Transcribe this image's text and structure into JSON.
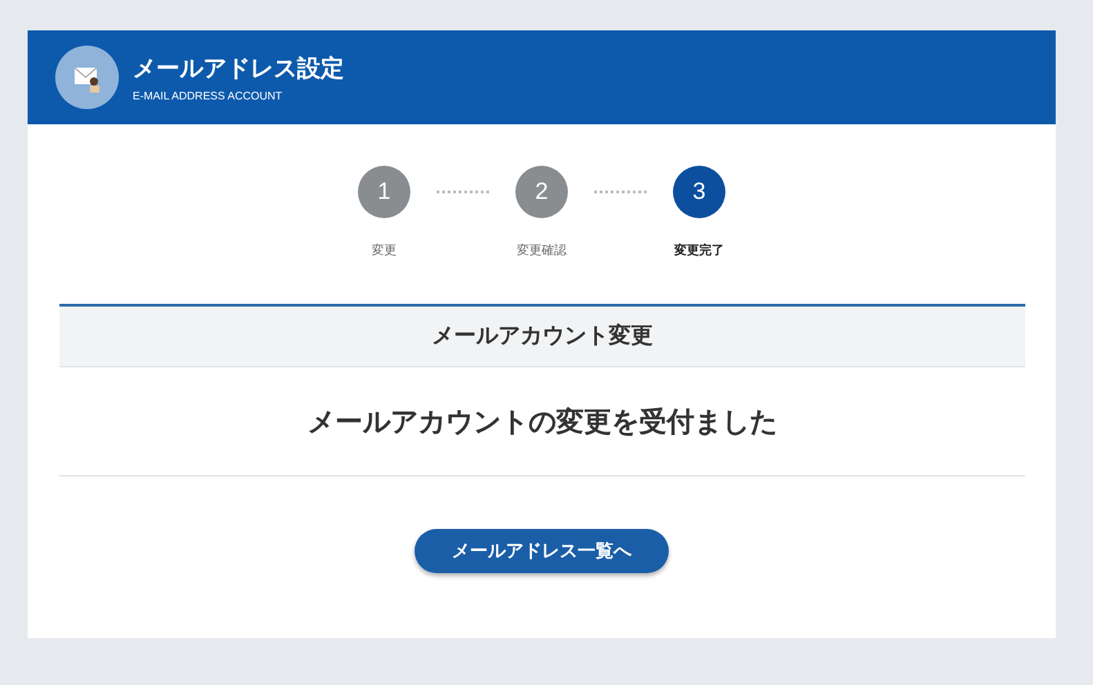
{
  "header": {
    "title": "メールアドレス設定",
    "subtitle": "E-MAIL ADDRESS ACCOUNT"
  },
  "steps": [
    {
      "number": "1",
      "label": "変更",
      "selected": false
    },
    {
      "number": "2",
      "label": "変更確認",
      "selected": false
    },
    {
      "number": "3",
      "label": "変更完了",
      "selected": true
    }
  ],
  "section": {
    "title": "メールアカウント変更",
    "message": "メールアカウントの変更を受付ました"
  },
  "button": {
    "label": "メールアドレス一覧へ"
  }
}
